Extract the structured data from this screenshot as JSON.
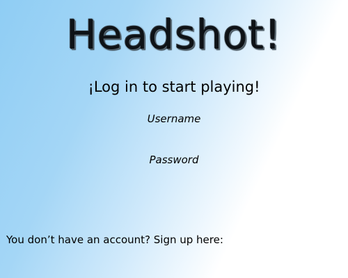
{
  "login": {
    "title": "Headshot!",
    "subtitle": "¡Log in to start playing!",
    "username_label": "Username",
    "password_label": "Password",
    "signup_prompt": "You don’t have an account? Sign up here:"
  }
}
